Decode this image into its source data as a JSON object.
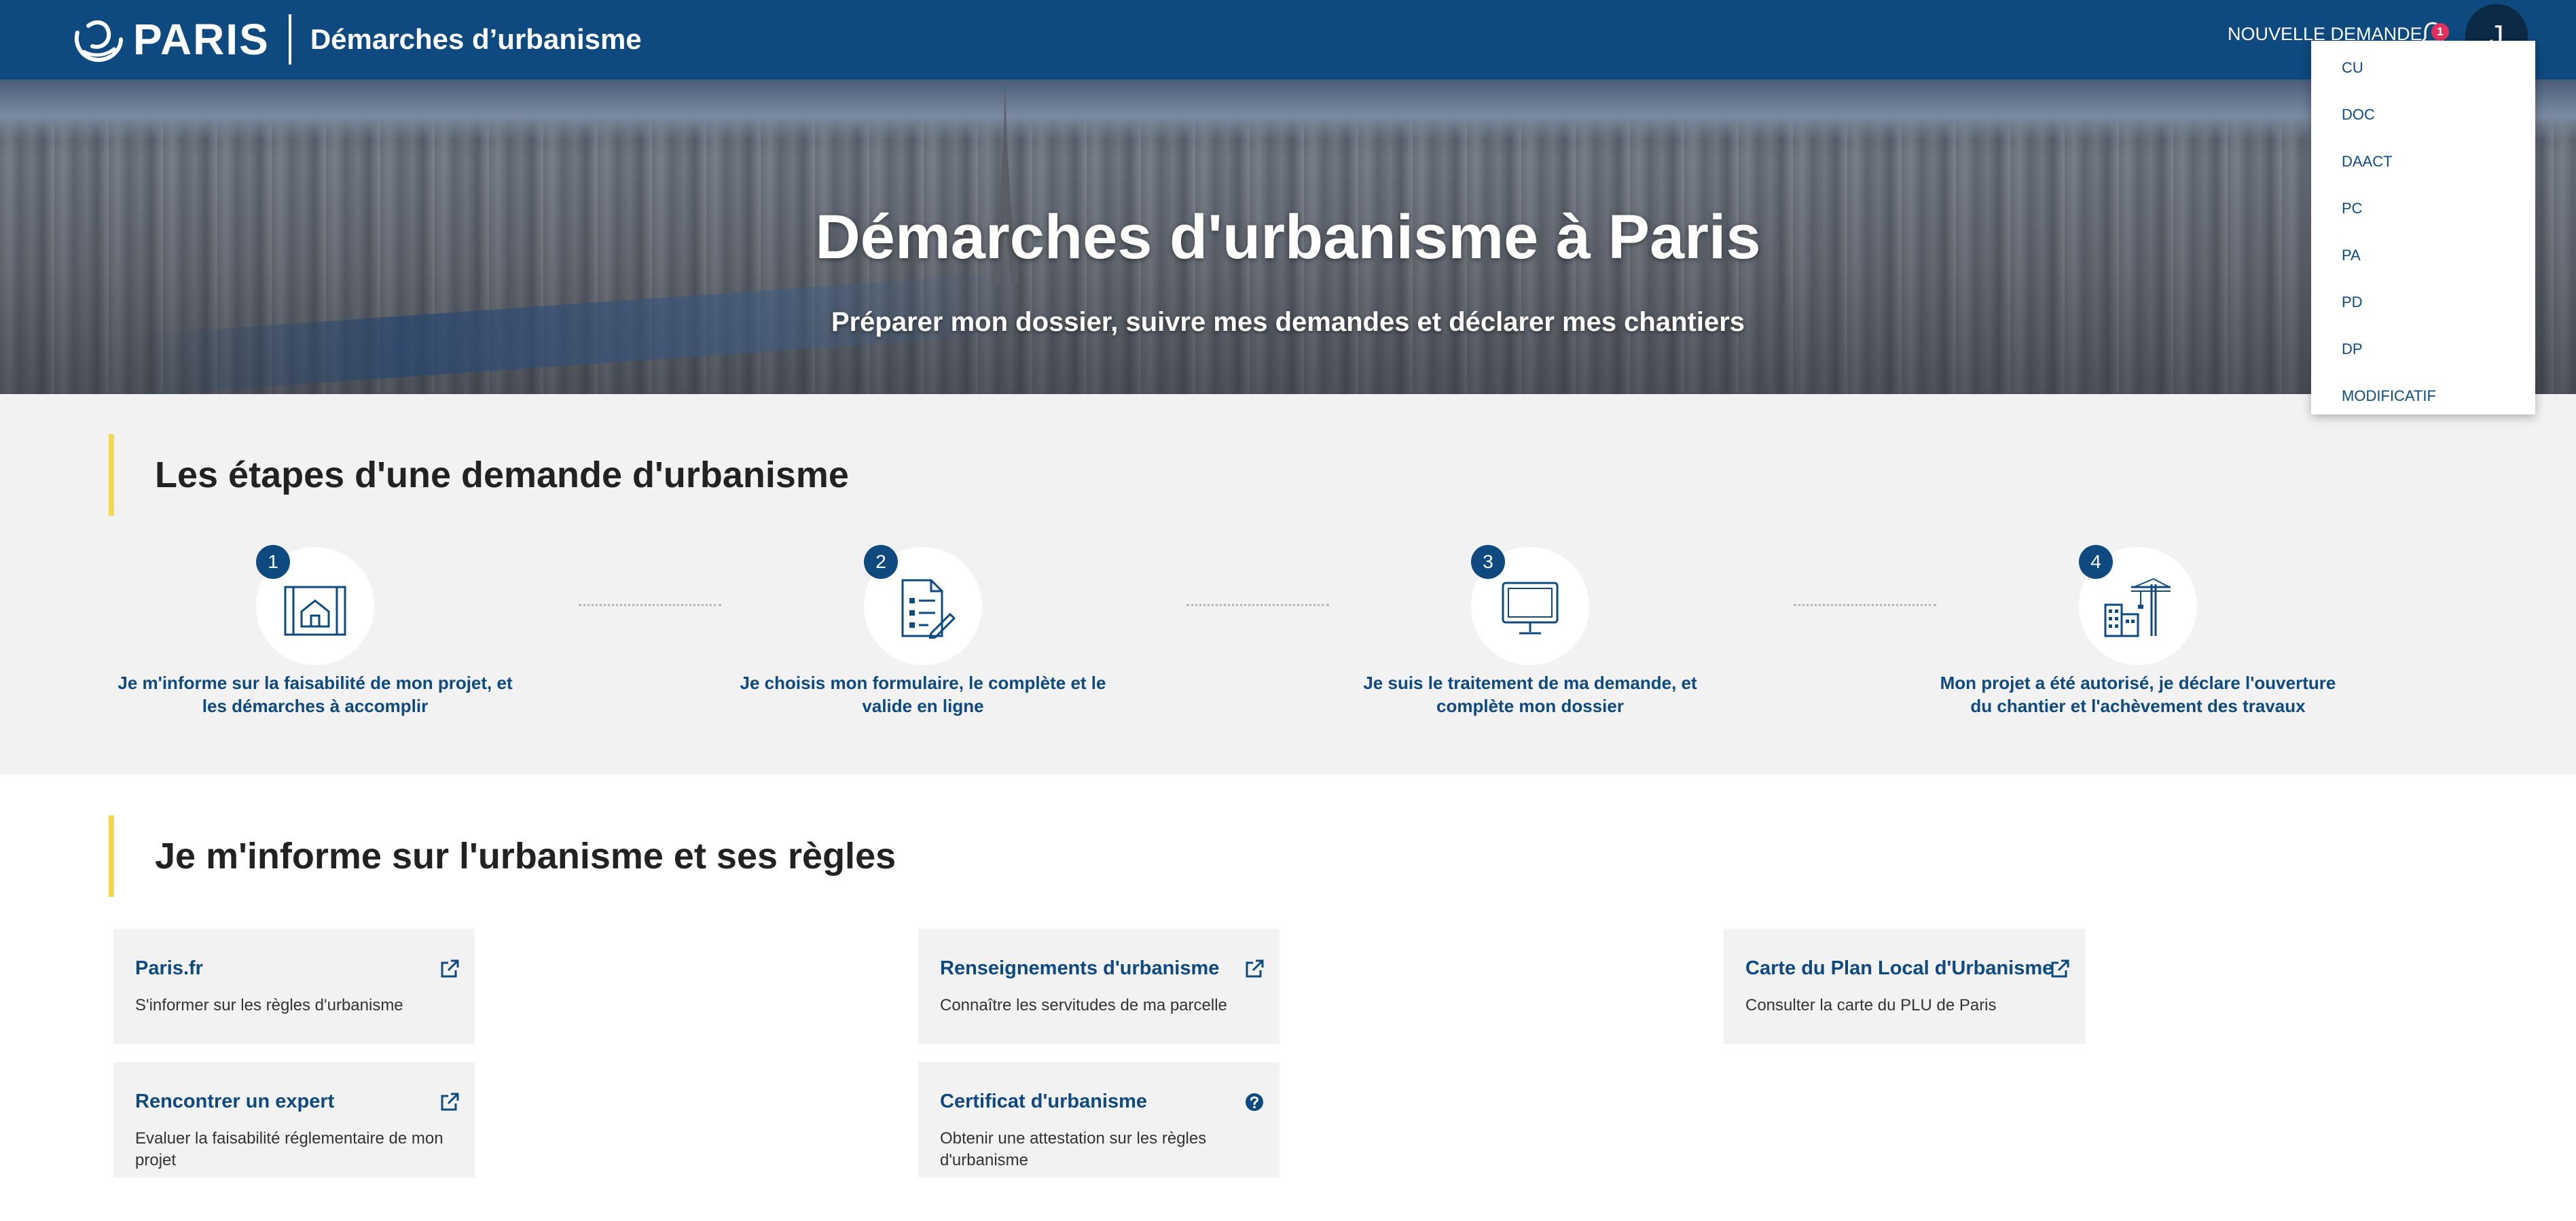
{
  "header": {
    "brand": "PARIS",
    "app_title": "Démarches d’urbanisme",
    "new_request_label": "NOUVELLE DEMANDE",
    "notification_count": "1",
    "avatar_initial": "J",
    "colors": {
      "primary": "#0e4a7f",
      "avatar": "#0a2a45",
      "badge": "#e0325d"
    }
  },
  "dropdown": {
    "items": [
      "CU",
      "DOC",
      "DAACT",
      "PC",
      "PA",
      "PD",
      "DP",
      "MODIFICATIF"
    ]
  },
  "hero": {
    "title": "Démarches d'urbanisme à Paris",
    "subtitle": "Préparer mon dossier, suivre mes demandes et déclarer mes chantiers"
  },
  "steps": {
    "title": "Les étapes d'une demande d'urbanisme",
    "accent_color": "#f2d750",
    "items": [
      {
        "number": "1",
        "icon": "blueprint-house-icon",
        "text": "Je m'informe sur la faisabilité de mon projet, et les démarches à accomplir"
      },
      {
        "number": "2",
        "icon": "form-document-icon",
        "text": "Je choisis mon formulaire, le complète et le valide en ligne"
      },
      {
        "number": "3",
        "icon": "computer-monitor-icon",
        "text": "Je suis le traitement de ma demande, et complète mon dossier"
      },
      {
        "number": "4",
        "icon": "construction-crane-icon",
        "text": "Mon projet a été autorisé, je déclare l'ouverture du chantier et l'achèvement des travaux"
      }
    ]
  },
  "info": {
    "title": "Je m'informe sur l'urbanisme et ses règles",
    "cards": [
      {
        "title": "Paris.fr",
        "desc": "S'informer sur les règles d'urbanisme",
        "icon": "external-link-icon"
      },
      {
        "title": "Renseignements d'urbanisme",
        "desc": "Connaître les servitudes de ma parcelle",
        "icon": "external-link-icon"
      },
      {
        "title": "Carte du Plan Local d'Urbanisme",
        "desc": "Consulter la carte du PLU de Paris",
        "icon": "external-link-icon"
      },
      {
        "title": "Rencontrer un expert",
        "desc": "Evaluer la faisabilité réglementaire de mon projet",
        "icon": "external-link-icon"
      },
      {
        "title": "Certificat d'urbanisme",
        "desc": "Obtenir une attestation sur les règles d'urbanisme",
        "icon": "help-icon"
      }
    ]
  }
}
